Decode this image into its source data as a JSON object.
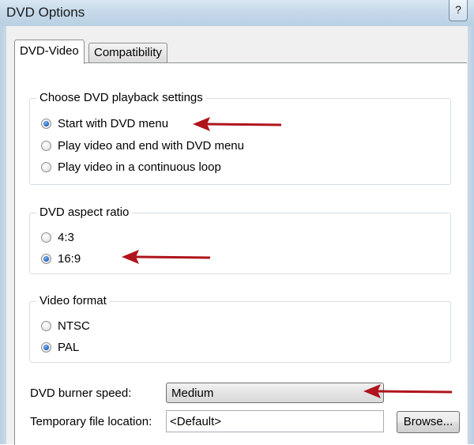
{
  "window": {
    "title": "DVD Options",
    "help_glyph": "?"
  },
  "tabs": [
    {
      "label": "DVD-Video",
      "active": true
    },
    {
      "label": "Compatibility",
      "active": false
    }
  ],
  "playback_group": {
    "label": "Choose DVD playback settings",
    "options": [
      {
        "label": "Start with DVD menu",
        "selected": true
      },
      {
        "label": "Play video and end with DVD menu",
        "selected": false
      },
      {
        "label": "Play video in a continuous loop",
        "selected": false
      }
    ]
  },
  "aspect_group": {
    "label": "DVD aspect ratio",
    "options": [
      {
        "label": "4:3",
        "selected": false
      },
      {
        "label": "16:9",
        "selected": true
      }
    ]
  },
  "format_group": {
    "label": "Video format",
    "options": [
      {
        "label": "NTSC",
        "selected": false
      },
      {
        "label": "PAL",
        "selected": true
      }
    ]
  },
  "burner_speed": {
    "label": "DVD burner speed:",
    "value": "Medium"
  },
  "temp_location": {
    "label": "Temporary file location:",
    "value": "<Default>",
    "browse_label": "Browse..."
  },
  "colors": {
    "annotation_arrow": "#b0141c",
    "accent_radio": "#1f5fb8"
  }
}
